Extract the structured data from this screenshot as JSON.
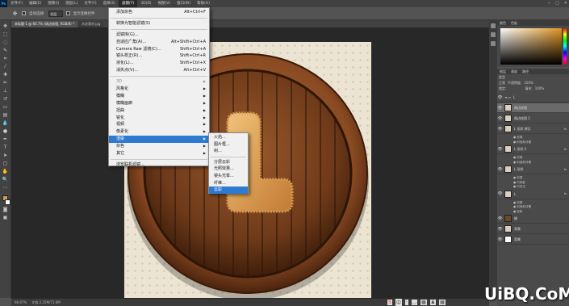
{
  "menubar": {
    "logo": "Ps",
    "items": [
      "文件(F)",
      "编辑(E)",
      "图像(I)",
      "图层(L)",
      "文字(Y)",
      "选择(S)",
      "滤镜(T)",
      "3D(D)",
      "视图(V)",
      "窗口(W)",
      "帮助(H)"
    ],
    "active_index": 6,
    "window_controls": [
      "─",
      "□",
      "✕"
    ]
  },
  "optbar": {
    "auto_select_label": "自动选择:",
    "auto_select_value": "图层",
    "show_transform_label": "显示变换控件"
  },
  "tabs": [
    {
      "label": "未标题-1 @ 66.7% (周边纹理, RGB/8) *",
      "active": true
    },
    {
      "label": "木纹素材.jpg",
      "active": false
    }
  ],
  "filter_menu": {
    "items": [
      {
        "label": "添加杂色",
        "shortcut": "Alt+Ctrl+F",
        "type": "item"
      },
      {
        "type": "sep"
      },
      {
        "label": "转换为智能滤镜(S)",
        "shortcut": "",
        "type": "item"
      },
      {
        "type": "sep"
      },
      {
        "label": "滤镜库(G)...",
        "shortcut": "",
        "type": "item"
      },
      {
        "label": "自适应广角(A)...",
        "shortcut": "Alt+Shift+Ctrl+A",
        "type": "item"
      },
      {
        "label": "Camera Raw 滤镜(C)...",
        "shortcut": "Shift+Ctrl+A",
        "type": "item"
      },
      {
        "label": "镜头校正(R)...",
        "shortcut": "Shift+Ctrl+R",
        "type": "item"
      },
      {
        "label": "液化(L)...",
        "shortcut": "Shift+Ctrl+X",
        "type": "item"
      },
      {
        "label": "消失点(V)...",
        "shortcut": "Alt+Ctrl+V",
        "type": "item"
      },
      {
        "type": "sep"
      },
      {
        "label": "3D",
        "submenu": true,
        "type": "item",
        "disabled": true
      },
      {
        "label": "风格化",
        "submenu": true,
        "type": "item"
      },
      {
        "label": "模糊",
        "submenu": true,
        "type": "item"
      },
      {
        "label": "模糊画廊",
        "submenu": true,
        "type": "item"
      },
      {
        "label": "扭曲",
        "submenu": true,
        "type": "item"
      },
      {
        "label": "锐化",
        "submenu": true,
        "type": "item"
      },
      {
        "label": "视频",
        "submenu": true,
        "type": "item"
      },
      {
        "label": "像素化",
        "submenu": true,
        "type": "item"
      },
      {
        "label": "渲染",
        "submenu": true,
        "type": "item",
        "highlighted": true
      },
      {
        "label": "杂色",
        "submenu": true,
        "type": "item"
      },
      {
        "label": "其它",
        "submenu": true,
        "type": "item"
      },
      {
        "type": "sep"
      },
      {
        "label": "浏览联机滤镜...",
        "shortcut": "",
        "type": "item"
      }
    ]
  },
  "render_submenu": {
    "items": [
      {
        "label": "火焰...",
        "type": "item"
      },
      {
        "label": "图片框...",
        "type": "item"
      },
      {
        "label": "树...",
        "type": "item"
      },
      {
        "type": "sep"
      },
      {
        "label": "分层云彩",
        "type": "item"
      },
      {
        "label": "光照效果...",
        "type": "item"
      },
      {
        "label": "镜头光晕...",
        "type": "item"
      },
      {
        "label": "纤维...",
        "type": "item"
      },
      {
        "label": "云彩",
        "type": "item",
        "highlighted": true
      }
    ]
  },
  "panels": {
    "color_tabs": [
      "颜色",
      "色板"
    ],
    "layers_tabs": [
      "图层",
      "通道",
      "路径"
    ],
    "kind_label": "类型",
    "blend_mode": "正常",
    "opacity_label": "不透明度:",
    "opacity_value": "100%",
    "lock_label": "锁定:",
    "fill_label": "填充:",
    "fill_value": "100%",
    "layers": [
      {
        "name": "L",
        "type": "group"
      },
      {
        "name": "周边纹理",
        "selected": true
      },
      {
        "name": "周边纹理 2"
      },
      {
        "name": "L 形状 拷贝",
        "fx": true,
        "effects": [
          "效果",
          "斜面和浮雕"
        ]
      },
      {
        "name": "L 形状 2",
        "fx": true,
        "effects": [
          "效果",
          "斜面和浮雕"
        ]
      },
      {
        "name": "L 形状",
        "fx": true,
        "effects": [
          "效果",
          "内阴影",
          "内发光"
        ]
      },
      {
        "name": "L",
        "fx": true,
        "effects": [
          "效果",
          "斜面和浮雕",
          "投影"
        ]
      },
      {
        "name": "桶"
      },
      {
        "name": "背景"
      },
      {
        "name": "背景"
      }
    ]
  },
  "statusbar": {
    "zoom": "66.67%",
    "doc_info": "文档:2.25M/71.6M"
  },
  "watermark": "UiBQ.CoM",
  "taskbar_icons": [
    "S",
    "中",
    "·",
    "◡",
    "▦",
    "♟",
    "▦"
  ]
}
